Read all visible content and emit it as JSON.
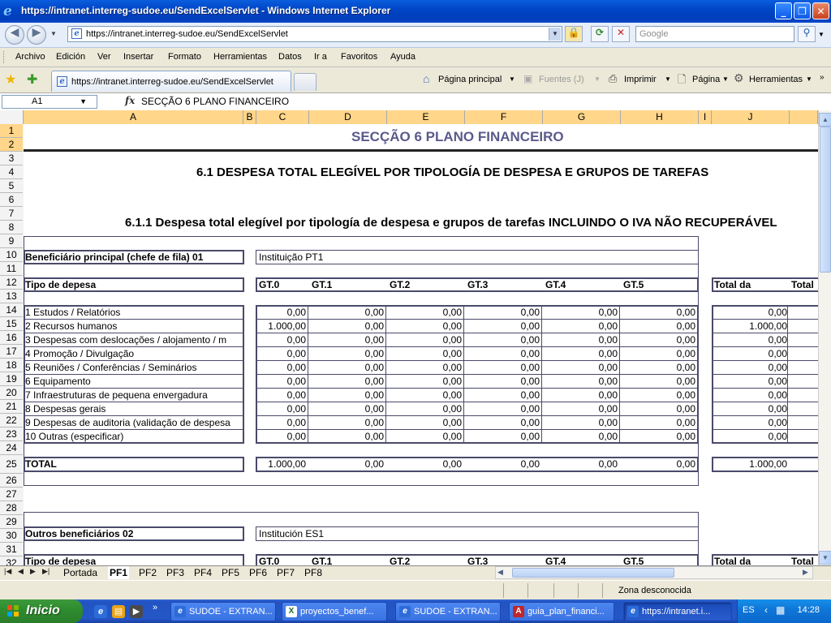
{
  "window": {
    "title": "https://intranet.interreg-sudoe.eu/SendExcelServlet - Windows Internet Explorer"
  },
  "address": {
    "url": "https://intranet.interreg-sudoe.eu/SendExcelServlet",
    "search_placeholder": "Google"
  },
  "menu": [
    "Archivo",
    "Edición",
    "Ver",
    "Insertar",
    "Formato",
    "Herramientas",
    "Datos",
    "Ir a",
    "Favoritos",
    "Ayuda"
  ],
  "tab": {
    "label": "https://intranet.interreg-sudoe.eu/SendExcelServlet"
  },
  "commands": {
    "home": "Página principal",
    "feeds": "Fuentes (J)",
    "print": "Imprimir",
    "page": "Página",
    "tools": "Herramientas"
  },
  "formula_bar": {
    "cell_ref": "A1",
    "fx": "fx",
    "content": "SECÇÃO 6  PLANO FINANCEIRO"
  },
  "columns": [
    "A",
    "B",
    "C",
    "D",
    "E",
    "F",
    "G",
    "H",
    "I",
    "J",
    ""
  ],
  "rows": [
    "1",
    "2",
    "3",
    "4",
    "5",
    "6",
    "7",
    "8",
    "9",
    "10",
    "11",
    "12",
    "13",
    "14",
    "15",
    "16",
    "17",
    "18",
    "19",
    "20",
    "21",
    "22",
    "23",
    "24",
    "25",
    "26",
    "27",
    "28",
    "29",
    "30",
    "31",
    "32"
  ],
  "sheet": {
    "section_title": "SECÇÃO 6  PLANO FINANCEIRO",
    "heading_61": "6.1 DESPESA TOTAL ELEGÍVEL POR TIPOLOGÍA DE DESPESA E GRUPOS DE TAREFAS",
    "heading_611": "6.1.1 Despesa total elegível por tipología de despesa e grupos de tarefas INCLUINDO O IVA NÃO RECUPERÁVEL",
    "block1": {
      "beneficiary_label": "Beneficiário principal (chefe de fila)  01",
      "beneficiary_name": "Instituição PT1",
      "type_label": "Tipo de depesa",
      "gt_headers": [
        "GT.0",
        "GT.1",
        "GT.2",
        "GT.3",
        "GT.4",
        "GT.5"
      ],
      "total_headers": [
        "Total da",
        "Total"
      ],
      "expense_rows": [
        {
          "label": "1 Estudos / Relatórios",
          "values": [
            "0,00",
            "0,00",
            "0,00",
            "0,00",
            "0,00",
            "0,00"
          ],
          "total": "0,00"
        },
        {
          "label": "2 Recursos humanos",
          "values": [
            "1.000,00",
            "0,00",
            "0,00",
            "0,00",
            "0,00",
            "0,00"
          ],
          "total": "1.000,00"
        },
        {
          "label": "3 Despesas com deslocações / alojamento / m",
          "values": [
            "0,00",
            "0,00",
            "0,00",
            "0,00",
            "0,00",
            "0,00"
          ],
          "total": "0,00"
        },
        {
          "label": "4 Promoção / Divulgação",
          "values": [
            "0,00",
            "0,00",
            "0,00",
            "0,00",
            "0,00",
            "0,00"
          ],
          "total": "0,00"
        },
        {
          "label": "5 Reuniões / Conferências / Seminários",
          "values": [
            "0,00",
            "0,00",
            "0,00",
            "0,00",
            "0,00",
            "0,00"
          ],
          "total": "0,00"
        },
        {
          "label": "6 Equipamento",
          "values": [
            "0,00",
            "0,00",
            "0,00",
            "0,00",
            "0,00",
            "0,00"
          ],
          "total": "0,00"
        },
        {
          "label": "7 Infraestruturas de pequena envergadura",
          "values": [
            "0,00",
            "0,00",
            "0,00",
            "0,00",
            "0,00",
            "0,00"
          ],
          "total": "0,00"
        },
        {
          "label": "8 Despesas gerais",
          "values": [
            "0,00",
            "0,00",
            "0,00",
            "0,00",
            "0,00",
            "0,00"
          ],
          "total": "0,00"
        },
        {
          "label": "9 Despesas de auditoria (validação de despesa",
          "values": [
            "0,00",
            "0,00",
            "0,00",
            "0,00",
            "0,00",
            "0,00"
          ],
          "total": "0,00"
        },
        {
          "label": "10 Outras (especificar)",
          "values": [
            "0,00",
            "0,00",
            "0,00",
            "0,00",
            "0,00",
            "0,00"
          ],
          "total": "0,00"
        }
      ],
      "total_row": {
        "label": "TOTAL",
        "values": [
          "1.000,00",
          "0,00",
          "0,00",
          "0,00",
          "0,00",
          "0,00"
        ],
        "total": "1.000,00"
      }
    },
    "block2": {
      "beneficiary_label": "Outros beneficiários 02",
      "beneficiary_name": "Institución ES1",
      "type_label": "Tipo de depesa",
      "gt_headers": [
        "GT.0",
        "GT.1",
        "GT.2",
        "GT.3",
        "GT.4",
        "GT.5"
      ],
      "total_headers": [
        "Total da",
        "Total"
      ]
    }
  },
  "sheet_tabs": {
    "items": [
      "Portada",
      "PF1",
      "PF2",
      "PF3",
      "PF4",
      "PF5",
      "PF6",
      "PF7",
      "PF8"
    ],
    "active": "PF1"
  },
  "status": {
    "zone": "Zona desconocida"
  },
  "taskbar": {
    "start": "Inicio",
    "tasks": [
      "SUDOE - EXTRAN...",
      "proyectos_benef...",
      "SUDOE - EXTRAN...",
      "guia_plan_financi...",
      "https://intranet.i..."
    ],
    "active_index": 4,
    "language": "ES",
    "clock": "14:28"
  },
  "colors": {
    "section_title": "#5a5a8c",
    "title_bar": "#0a5ede",
    "taskbar": "#2457c7",
    "start": "#2f8c2f",
    "cell_border": "#4a4a6a"
  }
}
